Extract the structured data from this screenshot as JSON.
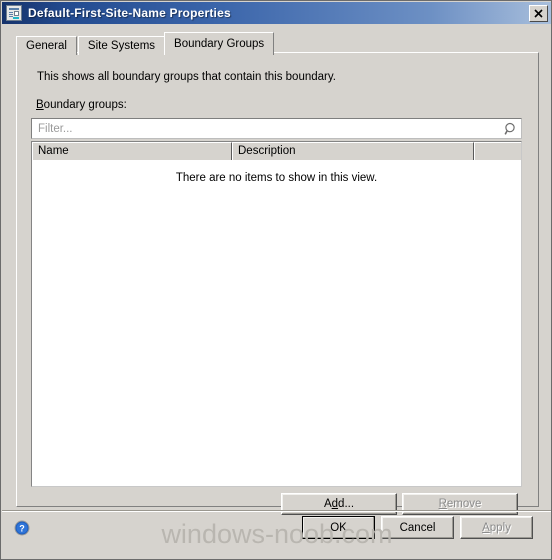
{
  "window": {
    "title": "Default-First-Site-Name Properties",
    "icon": "properties-document-icon",
    "close_label": "✕"
  },
  "tabs": [
    {
      "label": "General",
      "active": false
    },
    {
      "label": "Site Systems",
      "active": false
    },
    {
      "label": "Boundary Groups",
      "active": true
    }
  ],
  "panel": {
    "description": "This shows all boundary groups that contain this boundary.",
    "group_label_accel": "B",
    "group_label_rest": "oundary groups:"
  },
  "filter": {
    "value": "",
    "placeholder": "Filter...",
    "icon": "search-icon"
  },
  "listview": {
    "columns": [
      "Name",
      "Description",
      ""
    ],
    "rows": [],
    "empty_text": "There are no items to show in this view."
  },
  "list_actions": {
    "add": {
      "pre": "A",
      "accel": "d",
      "post": "d...",
      "enabled": true
    },
    "remove": {
      "accel": "R",
      "post": "emove",
      "enabled": false
    }
  },
  "footer": {
    "help_icon": "help-question-icon",
    "ok": "OK",
    "cancel": "Cancel",
    "apply_accel": "A",
    "apply_rest": "pply"
  },
  "watermark": "windows-noob.com",
  "colors": {
    "dialog_face": "#d6d3ce",
    "title_dark": "#15326b",
    "title_light": "#a9bfdc",
    "disabled_text": "#8c8c8c",
    "placeholder": "#9a9a9a",
    "watermark": "#b9b6b0"
  }
}
